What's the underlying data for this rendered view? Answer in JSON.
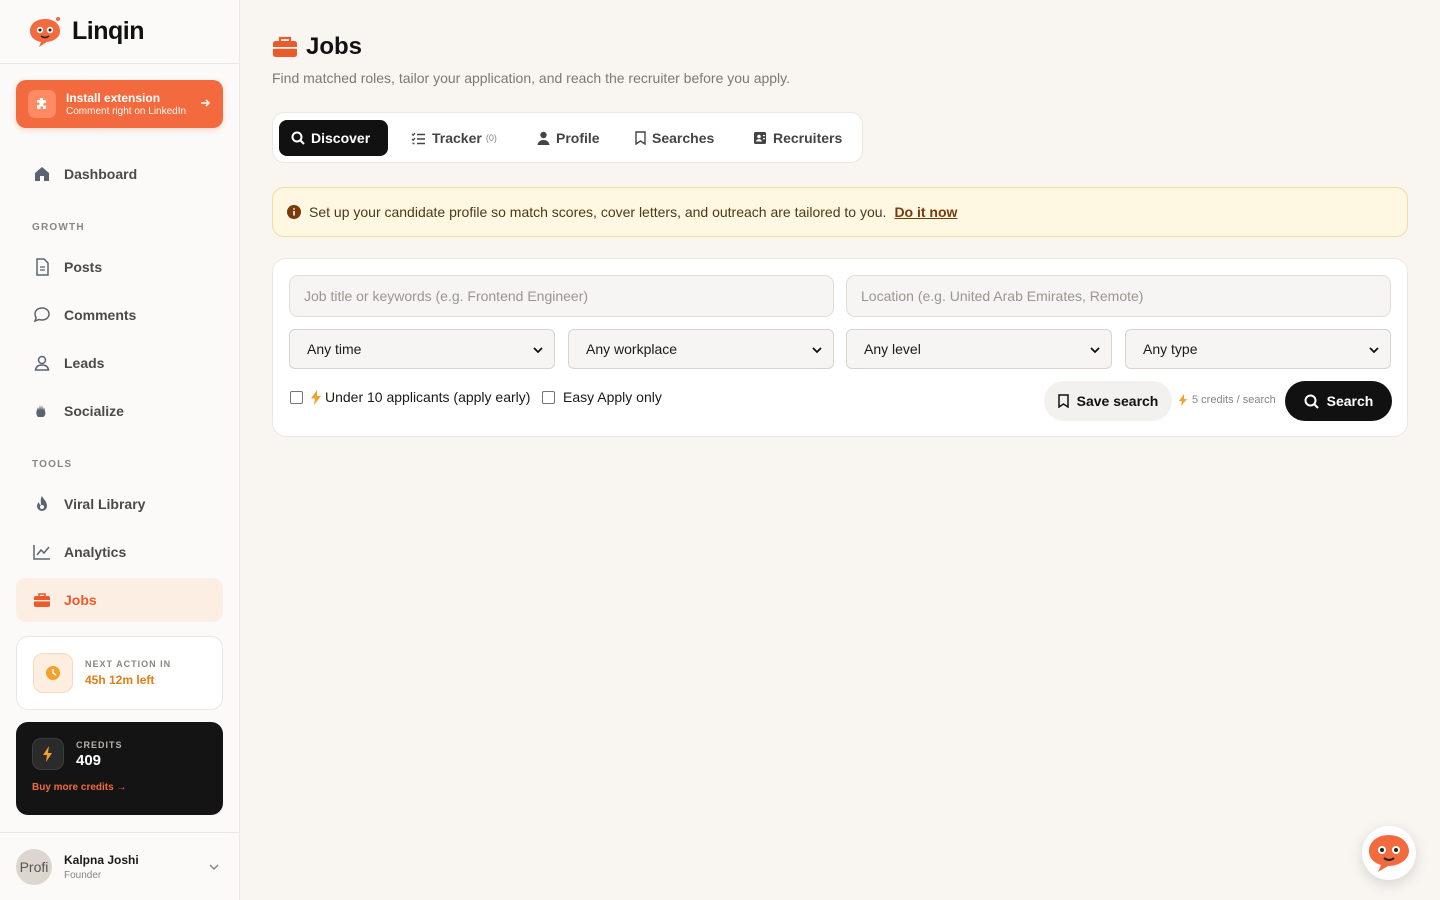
{
  "brand": {
    "name": "Linqin"
  },
  "install": {
    "title": "Install extension",
    "subtitle": "Comment right on LinkedIn"
  },
  "nav": {
    "dashboard": "Dashboard",
    "growth_label": "GROWTH",
    "posts": "Posts",
    "comments": "Comments",
    "leads": "Leads",
    "socialize": "Socialize",
    "tools_label": "TOOLS",
    "viral_library": "Viral Library",
    "analytics": "Analytics",
    "jobs": "Jobs"
  },
  "next_action": {
    "label": "NEXT ACTION IN",
    "value": "45h 12m left"
  },
  "credits": {
    "label": "CREDITS",
    "value": "409",
    "buy": "Buy more credits →"
  },
  "user": {
    "name": "Kalpna Joshi",
    "role": "Founder",
    "avatar_alt": "Profi"
  },
  "page": {
    "title": "Jobs",
    "subtitle": "Find matched roles, tailor your application, and reach the recruiter before you apply."
  },
  "tabs": {
    "discover": "Discover",
    "tracker": "Tracker",
    "tracker_count": "(0)",
    "profile": "Profile",
    "searches": "Searches",
    "recruiters": "Recruiters"
  },
  "banner": {
    "text": "Set up your candidate profile so match scores, cover letters, and outreach are tailored to you.",
    "link": "Do it now"
  },
  "search": {
    "keywords_placeholder": "Job title or keywords (e.g. Frontend Engineer)",
    "location_placeholder": "Location (e.g. United Arab Emirates, Remote)",
    "time": "Any time",
    "workplace": "Any workplace",
    "level": "Any level",
    "type": "Any type",
    "under10": "Under 10 applicants (apply early)",
    "easy_apply": "Easy Apply only",
    "save_label": "Save search",
    "cost": "5 credits / search",
    "search_label": "Search"
  },
  "colors": {
    "accent": "#f26a3d",
    "warning_bg": "#fef7e1",
    "dark": "#111111"
  }
}
